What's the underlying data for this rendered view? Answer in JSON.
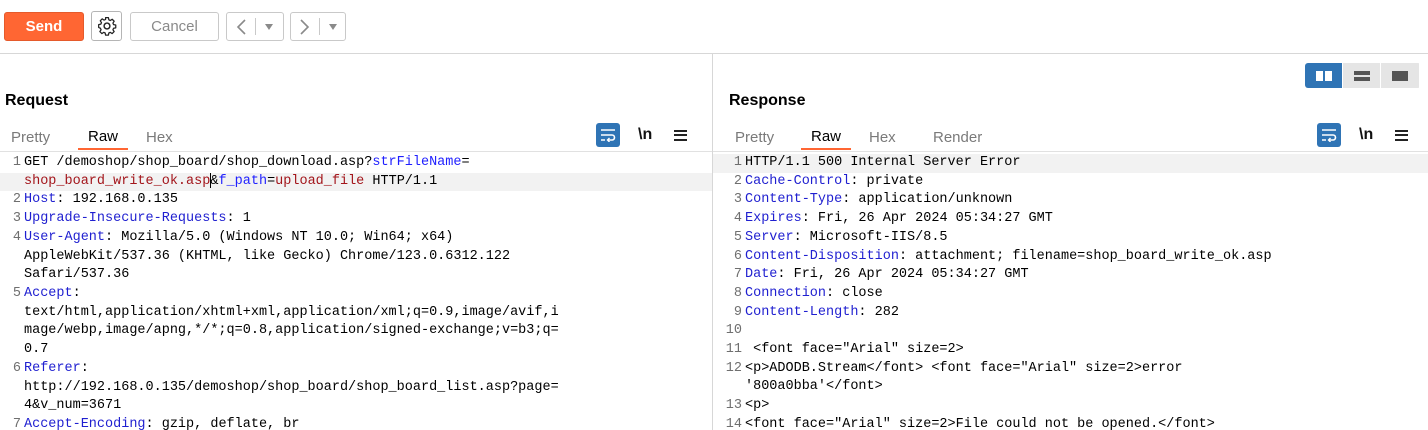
{
  "toolbar": {
    "send_label": "Send",
    "cancel_label": "Cancel"
  },
  "request": {
    "title": "Request",
    "tabs": [
      "Pretty",
      "Raw",
      "Hex"
    ],
    "active_tab": "Raw",
    "newline_label": "\\n",
    "lines": [
      {
        "num": "1",
        "parts": [
          [
            "GET /demoshop/shop_board/shop_download.asp?",
            ""
          ],
          [
            "strFileName",
            "kn"
          ],
          [
            "=",
            ""
          ]
        ]
      },
      {
        "num": "",
        "hl": true,
        "parts": [
          [
            "shop_board_write_ok.asp",
            "kv"
          ],
          [
            "&",
            ""
          ],
          [
            "f_path",
            "kn"
          ],
          [
            "=",
            ""
          ],
          [
            "upload_file",
            "kv"
          ],
          [
            " HTTP/1.1",
            ""
          ]
        ]
      },
      {
        "num": "2",
        "parts": [
          [
            "Host",
            "hn"
          ],
          [
            ": 192.168.0.135",
            ""
          ]
        ]
      },
      {
        "num": "3",
        "parts": [
          [
            "Upgrade-Insecure-Requests",
            "hn"
          ],
          [
            ": 1",
            ""
          ]
        ]
      },
      {
        "num": "4",
        "parts": [
          [
            "User-Agent",
            "hn"
          ],
          [
            ": Mozilla/5.0 (Windows NT 10.0; Win64; x64)",
            ""
          ]
        ]
      },
      {
        "num": "",
        "parts": [
          [
            "AppleWebKit/537.36 (KHTML, like Gecko) Chrome/123.0.6312.122",
            ""
          ]
        ]
      },
      {
        "num": "",
        "parts": [
          [
            "Safari/537.36",
            ""
          ]
        ]
      },
      {
        "num": "5",
        "parts": [
          [
            "Accept",
            "hn"
          ],
          [
            ":",
            ""
          ]
        ]
      },
      {
        "num": "",
        "parts": [
          [
            "text/html,application/xhtml+xml,application/xml;q=0.9,image/avif,i",
            ""
          ]
        ]
      },
      {
        "num": "",
        "parts": [
          [
            "mage/webp,image/apng,*/*;q=0.8,application/signed-exchange;v=b3;q=",
            ""
          ]
        ]
      },
      {
        "num": "",
        "parts": [
          [
            "0.7",
            ""
          ]
        ]
      },
      {
        "num": "6",
        "parts": [
          [
            "Referer",
            "hn"
          ],
          [
            ":",
            ""
          ]
        ]
      },
      {
        "num": "",
        "parts": [
          [
            "http://192.168.0.135/demoshop/shop_board/shop_board_list.asp?page=",
            ""
          ]
        ]
      },
      {
        "num": "",
        "parts": [
          [
            "4&v_num=3671",
            ""
          ]
        ]
      },
      {
        "num": "7",
        "parts": [
          [
            "Accept-Encoding",
            "hn"
          ],
          [
            ": gzip, deflate, br",
            ""
          ]
        ]
      }
    ]
  },
  "response": {
    "title": "Response",
    "tabs": [
      "Pretty",
      "Raw",
      "Hex",
      "Render"
    ],
    "active_tab": "Raw",
    "newline_label": "\\n",
    "lines": [
      {
        "num": "1",
        "hl": true,
        "parts": [
          [
            "HTTP/1.1 500 Internal Server Error",
            ""
          ]
        ]
      },
      {
        "num": "2",
        "parts": [
          [
            "Cache-Control",
            "hn"
          ],
          [
            ": private",
            ""
          ]
        ]
      },
      {
        "num": "3",
        "parts": [
          [
            "Content-Type",
            "hn"
          ],
          [
            ": application/unknown",
            ""
          ]
        ]
      },
      {
        "num": "4",
        "parts": [
          [
            "Expires",
            "hn"
          ],
          [
            ": Fri, 26 Apr 2024 05:34:27 GMT",
            ""
          ]
        ]
      },
      {
        "num": "5",
        "parts": [
          [
            "Server",
            "hn"
          ],
          [
            ": Microsoft-IIS/8.5",
            ""
          ]
        ]
      },
      {
        "num": "6",
        "parts": [
          [
            "Content-Disposition",
            "hn"
          ],
          [
            ": attachment; filename=shop_board_write_ok.asp",
            ""
          ]
        ]
      },
      {
        "num": "7",
        "parts": [
          [
            "Date",
            "hn"
          ],
          [
            ": Fri, 26 Apr 2024 05:34:27 GMT",
            ""
          ]
        ]
      },
      {
        "num": "8",
        "parts": [
          [
            "Connection",
            "hn"
          ],
          [
            ": close",
            ""
          ]
        ]
      },
      {
        "num": "9",
        "parts": [
          [
            "Content-Length",
            "hn"
          ],
          [
            ": 282",
            ""
          ]
        ]
      },
      {
        "num": "10",
        "parts": [
          [
            "",
            ""
          ]
        ]
      },
      {
        "num": "11",
        "parts": [
          [
            " <font face=\"Arial\" size=2>",
            ""
          ]
        ]
      },
      {
        "num": "12",
        "parts": [
          [
            "<p>ADODB.Stream</font> <font face=\"Arial\" size=2>error",
            ""
          ]
        ]
      },
      {
        "num": "",
        "parts": [
          [
            "'800a0bba'</font>",
            ""
          ]
        ]
      },
      {
        "num": "13",
        "parts": [
          [
            "<p>",
            ""
          ]
        ]
      },
      {
        "num": "14",
        "parts": [
          [
            "<font face=\"Arial\" size=2>File could not be opened.</font>",
            ""
          ]
        ]
      }
    ]
  },
  "colors": {
    "accent": "#ff6633",
    "active_icon": "#2f74b5",
    "param_name": "#1f1fff",
    "param_value": "#a3151b"
  }
}
